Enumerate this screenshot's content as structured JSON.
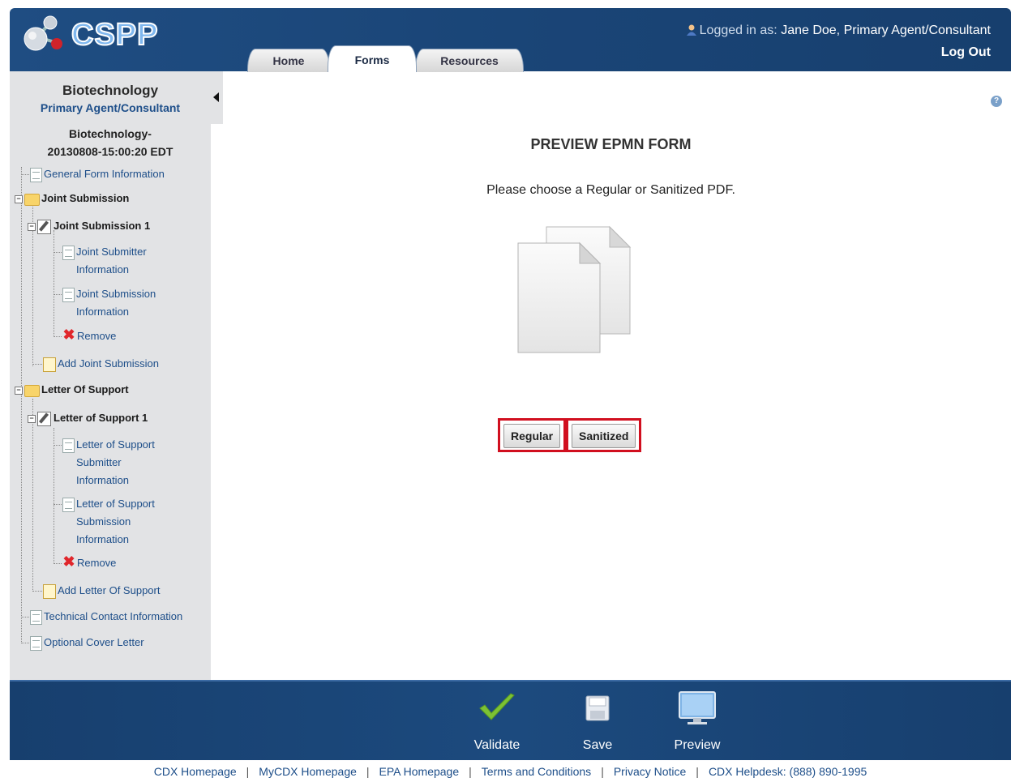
{
  "app": {
    "logo_text": "CSPP",
    "colors": {
      "header": "#1c4a7e",
      "sidebar": "#e2e3e5",
      "highlight": "#d10f1f",
      "link": "#1d4e89"
    }
  },
  "tabs": [
    {
      "label": "Home",
      "active": false
    },
    {
      "label": "Forms",
      "active": true
    },
    {
      "label": "Resources",
      "active": false
    }
  ],
  "user": {
    "prefix": "Logged in as: ",
    "name": "Jane Doe, Primary Agent/Consultant",
    "logout": "Log Out",
    "icon": "user-icon"
  },
  "sidebar": {
    "title": "Biotechnology",
    "role": "Primary Agent/Consultant",
    "submission_line1": "Biotechnology-",
    "submission_line2": "20130808-15:00:20 EDT",
    "items": [
      {
        "label": "General Form Information"
      },
      {
        "label": "Joint Submission"
      },
      {
        "label": "Joint Submission 1"
      },
      {
        "label": "Joint Submitter Information"
      },
      {
        "label": "Joint Submission Information"
      },
      {
        "label": "Remove"
      },
      {
        "label": "Add Joint Submission"
      },
      {
        "label": "Letter Of Support"
      },
      {
        "label": "Letter of Support 1"
      },
      {
        "label": "Letter of Support Submitter Information"
      },
      {
        "label": "Letter of Support Submission Information"
      },
      {
        "label": "Remove"
      },
      {
        "label": "Add Letter Of Support"
      },
      {
        "label": "Technical Contact Information"
      },
      {
        "label": "Optional Cover Letter"
      }
    ]
  },
  "main": {
    "title": "PREVIEW EPMN FORM",
    "instruction": "Please choose a Regular or Sanitized PDF.",
    "buttons": {
      "regular": "Regular",
      "sanitized": "Sanitized"
    }
  },
  "footer": {
    "actions": [
      {
        "label": "Validate",
        "icon": "checkmark-icon"
      },
      {
        "label": "Save",
        "icon": "floppy-disk-icon"
      },
      {
        "label": "Preview",
        "icon": "monitor-icon"
      }
    ],
    "links": [
      "CDX Homepage",
      "MyCDX Homepage",
      "EPA Homepage",
      "Terms and Conditions",
      "Privacy Notice",
      "CDX Helpdesk: (888) 890-1995"
    ]
  }
}
